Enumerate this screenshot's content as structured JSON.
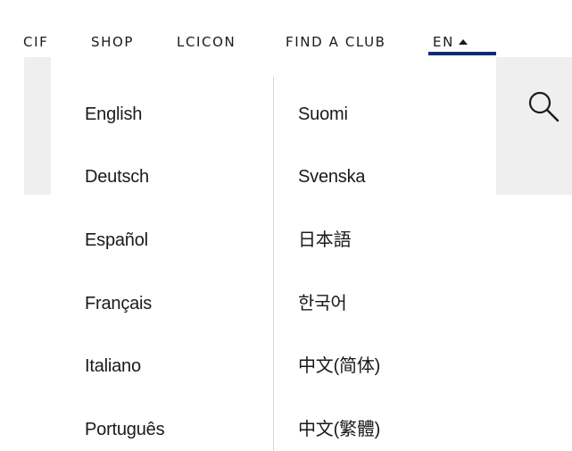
{
  "nav": {
    "items": [
      {
        "label": "CIF"
      },
      {
        "label": "SHOP"
      },
      {
        "label": "LCICON"
      },
      {
        "label": "FIND A CLUB"
      }
    ],
    "language_toggle": {
      "label": "EN",
      "caret_icon": "caret-up-icon"
    },
    "search_icon": "search-icon"
  },
  "language_menu": {
    "left_column": [
      {
        "label": "English"
      },
      {
        "label": "Deutsch"
      },
      {
        "label": "Español"
      },
      {
        "label": "Français"
      },
      {
        "label": "Italiano"
      },
      {
        "label": "Português"
      }
    ],
    "right_column": [
      {
        "label": "Suomi"
      },
      {
        "label": "Svenska"
      },
      {
        "label": "日本語"
      },
      {
        "label": "한국어"
      },
      {
        "label": "中文(简体)"
      },
      {
        "label": "中文(繁體)"
      }
    ]
  },
  "colors": {
    "accent_underline": "#0e2a78",
    "background_band": "#efeff0",
    "text": "#1a1a1a",
    "divider": "#d6d6d6"
  }
}
